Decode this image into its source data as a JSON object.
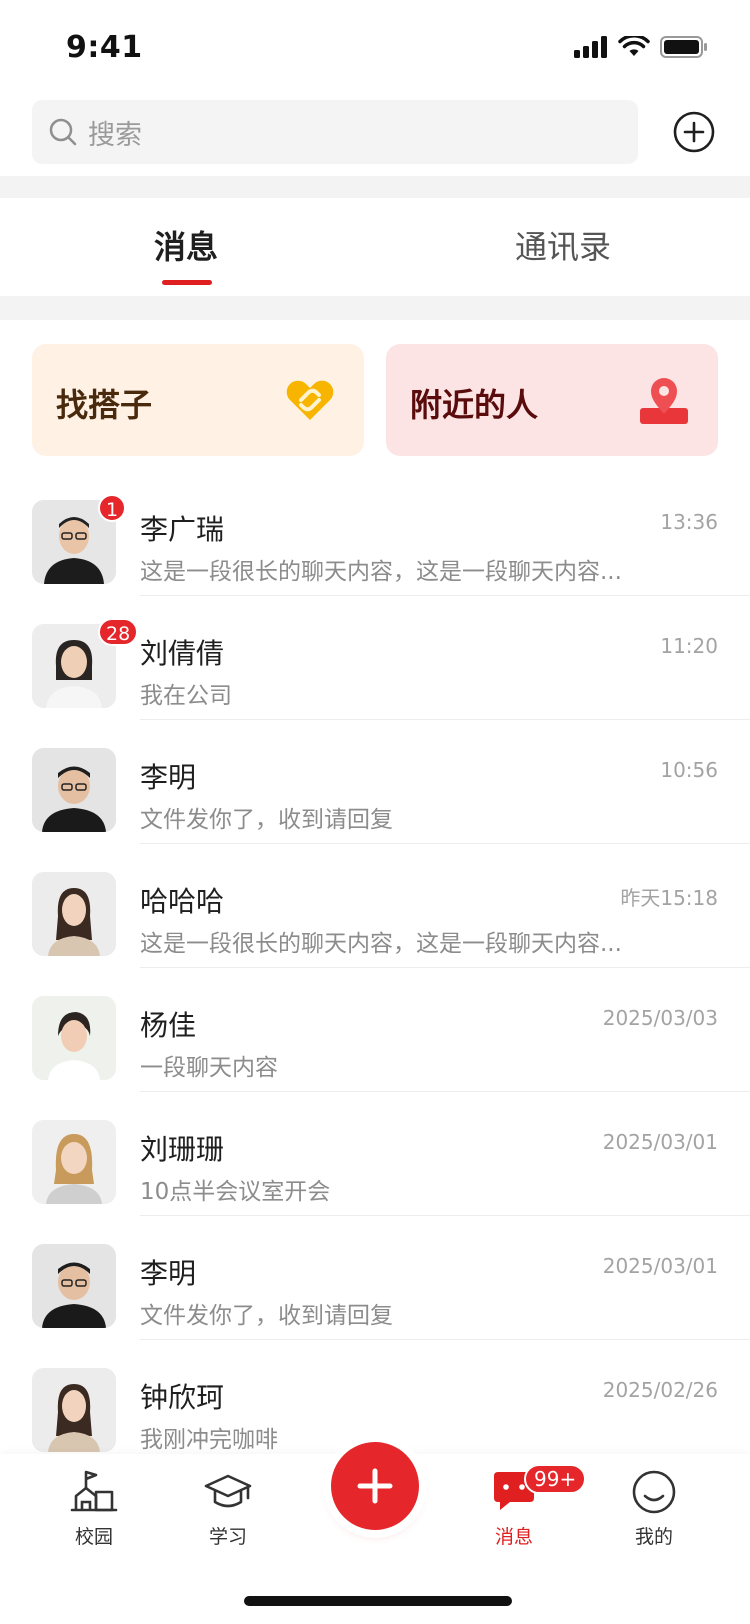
{
  "status_bar": {
    "time": "9:41"
  },
  "search": {
    "placeholder": "搜索"
  },
  "tabs": [
    {
      "label": "消息",
      "active": true
    },
    {
      "label": "通讯录",
      "active": false
    }
  ],
  "cards": [
    {
      "label": "找搭子",
      "icon": "handshake-heart-icon"
    },
    {
      "label": "附近的人",
      "icon": "location-pin-icon"
    }
  ],
  "conversations": [
    {
      "name": "李广瑞",
      "preview": "这是一段很长的聊天内容，这是一段聊天内容...",
      "time": "13:36",
      "unread": "1",
      "avatar": "man-glasses-avatar"
    },
    {
      "name": "刘倩倩",
      "preview": "我在公司",
      "time": "11:20",
      "unread": "28",
      "avatar": "woman-avatar"
    },
    {
      "name": "李明",
      "preview": "文件发你了，收到请回复",
      "time": "10:56",
      "unread": "",
      "avatar": "man-glasses-avatar"
    },
    {
      "name": "哈哈哈",
      "preview": "这是一段很长的聊天内容，这是一段聊天内容...",
      "time": "昨天15:18",
      "unread": "",
      "avatar": "woman-avatar"
    },
    {
      "name": "杨佳",
      "preview": "一段聊天内容",
      "time": "2025/03/03",
      "unread": "",
      "avatar": "woman-avatar"
    },
    {
      "name": "刘珊珊",
      "preview": "10点半会议室开会",
      "time": "2025/03/01",
      "unread": "",
      "avatar": "woman-avatar"
    },
    {
      "name": "李明",
      "preview": "文件发你了，收到请回复",
      "time": "2025/03/01",
      "unread": "",
      "avatar": "man-glasses-avatar"
    },
    {
      "name": "钟欣珂",
      "preview": "我刚冲完咖啡",
      "time": "2025/02/26",
      "unread": "",
      "avatar": "woman-avatar"
    }
  ],
  "tabbar": {
    "items": [
      {
        "label": "校园",
        "icon": "campus-icon",
        "active": false
      },
      {
        "label": "学习",
        "icon": "graduation-cap-icon",
        "active": false
      },
      {
        "label": "",
        "icon": "plus-icon",
        "active": false
      },
      {
        "label": "消息",
        "icon": "chat-bubble-icon",
        "active": true,
        "badge": "99+"
      },
      {
        "label": "我的",
        "icon": "smile-icon",
        "active": false
      }
    ]
  },
  "colors": {
    "accent": "#e02020",
    "partner_card_bg": "#fff1e4",
    "nearby_card_bg": "#fde4e4",
    "partner_icon": "#f7b500"
  }
}
